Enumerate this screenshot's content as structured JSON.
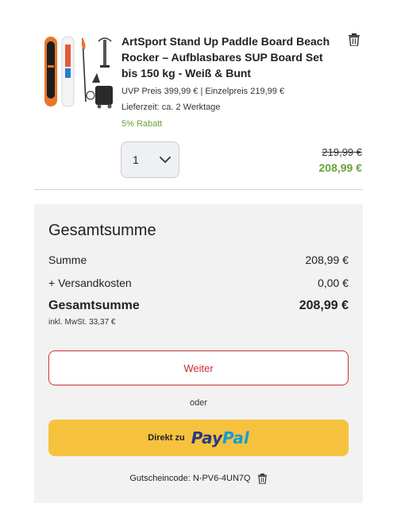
{
  "product": {
    "title": "ArtSport Stand Up Paddle Board Beach Rocker – Aufblasbares SUP Board Set bis 150 kg - Weiß & Bunt",
    "price_info": "UVP Preis  399,99 € | Einzelpreis  219,99 €",
    "delivery": "Lieferzeit:  ca. 2 Werktage",
    "discount": "5% Rabatt",
    "quantity": "1",
    "old_price": "219,99 €",
    "new_price": "208,99 €",
    "accent_green": "#6aa33a"
  },
  "summary": {
    "heading": "Gesamtsumme",
    "sum_label": "Summe",
    "sum_value": "208,99 €",
    "shipping_label": "+ Versandkosten",
    "shipping_value": "0,00 €",
    "total_label": "Gesamtsumme",
    "total_value": "208,99 €",
    "tax_note": "inkl. MwSt. 33,37 €",
    "continue_label": "Weiter",
    "or_label": "oder",
    "paypal_label": "Direkt zu",
    "paypal_brand_pay": "Pay",
    "paypal_brand_pal": "Pal",
    "voucher": "Gutscheincode: N-PV6-4UN7Q",
    "accent_red": "#d32f3a",
    "paypal_yellow": "#f6c23e"
  },
  "icons": {
    "remove_item": "trash-icon",
    "remove_voucher": "trash-icon",
    "quantity_dropdown": "chevron-down-icon"
  }
}
